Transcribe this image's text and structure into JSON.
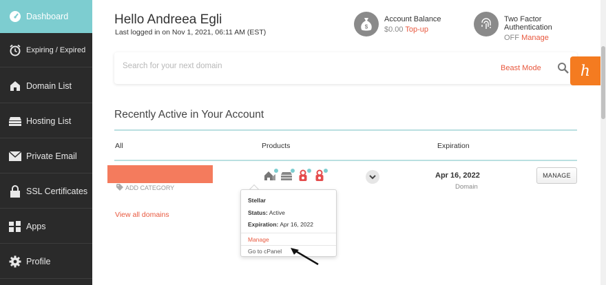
{
  "sidebar": {
    "items": [
      {
        "label": "Dashboard",
        "icon": "speedometer-icon",
        "active": true
      },
      {
        "label": "Expiring / Expired",
        "icon": "alarm-clock-icon"
      },
      {
        "label": "Domain List",
        "icon": "house-icon"
      },
      {
        "label": "Hosting List",
        "icon": "server-icon"
      },
      {
        "label": "Private Email",
        "icon": "envelope-icon"
      },
      {
        "label": "SSL Certificates",
        "icon": "lock-icon"
      },
      {
        "label": "Apps",
        "icon": "apps-icon"
      },
      {
        "label": "Profile",
        "icon": "gear-icon"
      }
    ]
  },
  "header": {
    "greeting": "Hello Andreea Egli",
    "last_login": "Last logged in on Nov 1, 2021, 06:11 AM (EST)",
    "balance_title": "Account Balance",
    "balance_value": "$0.00",
    "topup_label": "Top-up",
    "tfa_title": "Two Factor Authentication",
    "tfa_status": "OFF",
    "tfa_manage": "Manage"
  },
  "search": {
    "placeholder": "Search for your next domain",
    "beast_mode": "Beast Mode"
  },
  "help": {
    "glyph": "ℎ"
  },
  "recent": {
    "title": "Recently Active in Your Account",
    "columns": [
      "All",
      "Products",
      "Expiration"
    ],
    "row": {
      "add_category": "ADD CATEGORY",
      "expiration_date": "Apr 16, 2022",
      "expiration_type": "Domain",
      "manage_label": "MANAGE",
      "product_icons": [
        "hosting-icon",
        "server-icon",
        "ssl-icon",
        "ssl-icon"
      ]
    },
    "view_all": "View all domains"
  },
  "popup": {
    "title": "Stellar",
    "status_label": "Status:",
    "status_value": "Active",
    "expiration_label": "Expiration:",
    "expiration_value": "Apr 16, 2022",
    "manage": "Manage",
    "cpanel": "Go to cPanel"
  },
  "colors": {
    "accent_teal": "#7dcdd0",
    "accent_orange": "#e8583e",
    "sidebar_bg": "#2a2a2a",
    "help_orange": "#f47b20"
  }
}
